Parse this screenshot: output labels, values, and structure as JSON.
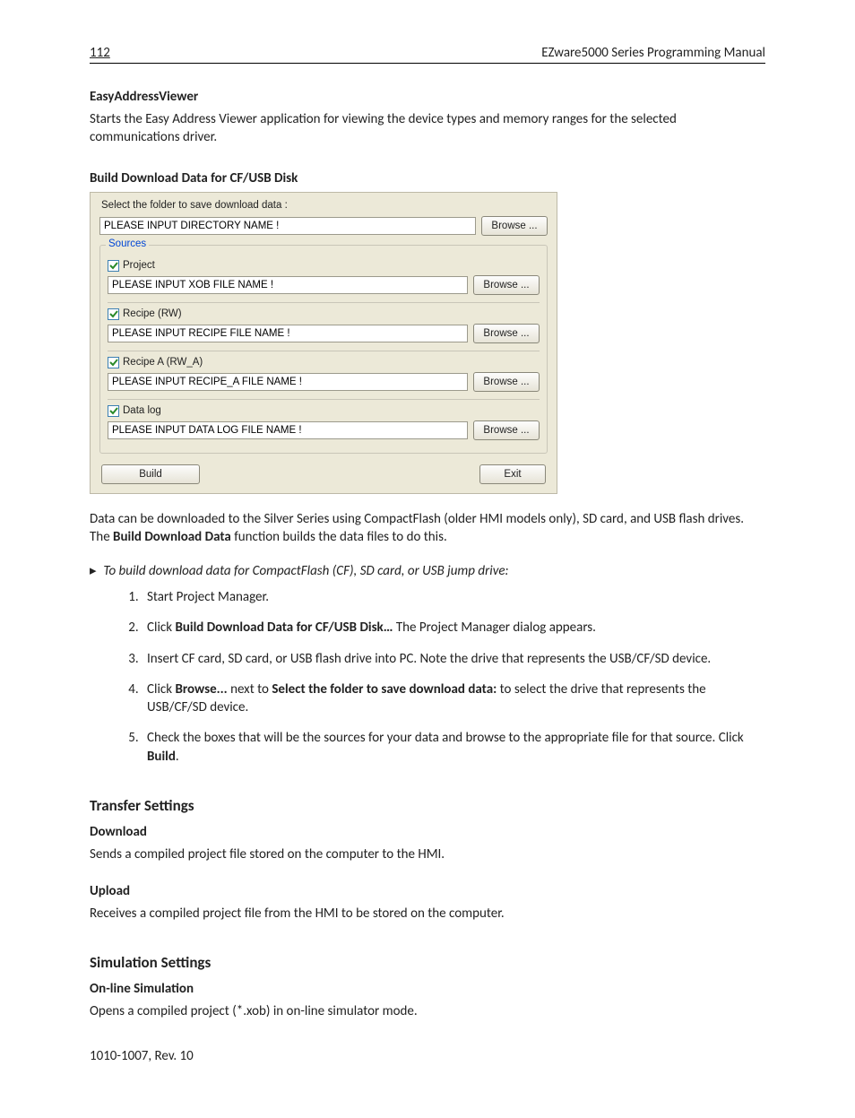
{
  "header": {
    "page_number": "112",
    "manual_title": "EZware5000 Series Programming Manual"
  },
  "easy_addr": {
    "heading": "EasyAddressViewer",
    "body": "Starts the Easy Address Viewer application for viewing the device types and memory ranges for the selected communications driver."
  },
  "build_dl": {
    "heading": "Build Download Data for CF/USB Disk",
    "post1a": "Data can be downloaded to the Silver Series using  CompactFlash (older HMI models only), SD card, and USB flash drives. The ",
    "post1b": "Build Download Data",
    "post1c": " function builds the data files to do this.",
    "instr": "To build download data for CompactFlash (CF), SD card, or USB jump drive:",
    "steps": {
      "s1": "Start Project Manager.",
      "s2a": "Click ",
      "s2b": "Build Download Data for CF/USB Disk…",
      "s2c": " The Project Manager dialog appears.",
      "s3": "Insert CF card, SD card, or USB flash drive into PC. Note the drive that represents the USB/CF/SD device.",
      "s4a": "Click ",
      "s4b": "Browse...",
      "s4c": " next to ",
      "s4d": "Select the folder to save download data:",
      "s4e": " to select the drive that represents the USB/CF/SD device.",
      "s5a": "Check the boxes that will be the sources for your data and browse to the appropriate file for that source. Click ",
      "s5b": "Build",
      "s5c": "."
    }
  },
  "dialog": {
    "folder_label": "Select the folder to save download data  :",
    "dir_value": "PLEASE INPUT DIRECTORY NAME !",
    "browse": "Browse ...",
    "sources_legend": "Sources",
    "project_label": "Project",
    "xob_value": "PLEASE INPUT XOB FILE NAME !",
    "recipe_label": "Recipe (RW)",
    "recipe_value": "PLEASE INPUT RECIPE FILE NAME !",
    "recipe_a_label": "Recipe A (RW_A)",
    "recipe_a_value": "PLEASE INPUT RECIPE_A FILE NAME !",
    "datalog_label": "Data log",
    "datalog_value": "PLEASE INPUT DATA LOG FILE NAME !",
    "build_btn": "Build",
    "exit_btn": "Exit"
  },
  "transfer": {
    "heading": "Transfer Settings",
    "download_h": "Download",
    "download_body": "Sends a compiled project file stored on the computer to the HMI.",
    "upload_h": "Upload",
    "upload_body": "Receives a compiled project file from the HMI to be stored on the computer."
  },
  "simulation": {
    "heading": "Simulation Settings",
    "online_h": "On-line Simulation",
    "online_body": "Opens a compiled project (*.xob) in on-line simulator mode."
  },
  "footer": "1010-1007, Rev. 10"
}
